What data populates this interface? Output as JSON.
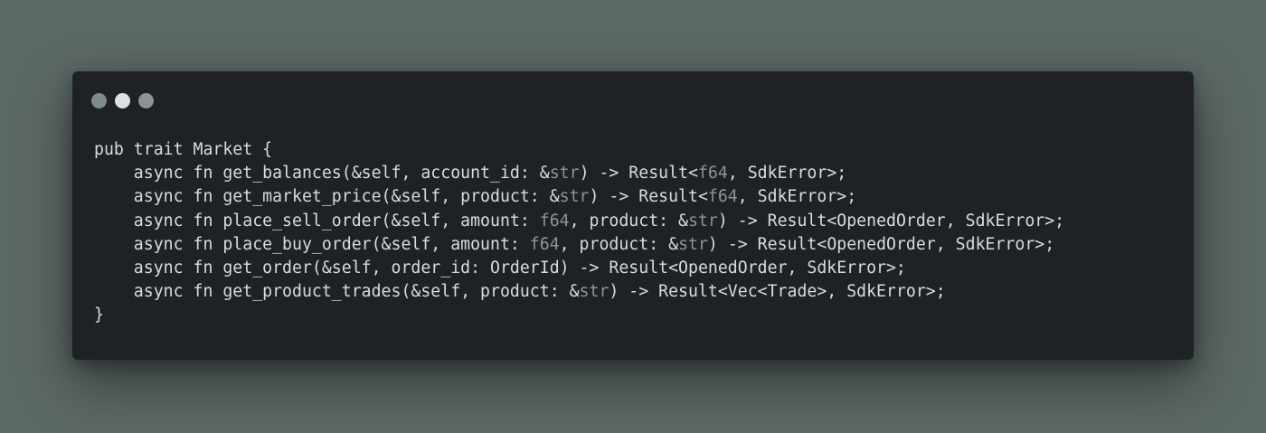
{
  "window": {
    "traffic_lights": [
      "close",
      "minimize",
      "maximize"
    ]
  },
  "colors": {
    "background": "#5c6866",
    "window": "#1e2224",
    "text": "#d9dcdc",
    "primitive_type": "#8b9594"
  },
  "code": {
    "language": "rust",
    "lines": [
      [
        {
          "t": "pub trait Market {",
          "c": "tk"
        }
      ],
      [
        {
          "t": "    async fn get_balances(&self, account_id: &",
          "c": "tk"
        },
        {
          "t": "str",
          "c": "tk-prim"
        },
        {
          "t": ") -> Result<",
          "c": "tk"
        },
        {
          "t": "f64",
          "c": "tk-prim"
        },
        {
          "t": ", SdkError>;",
          "c": "tk"
        }
      ],
      [
        {
          "t": "    async fn get_market_price(&self, product: &",
          "c": "tk"
        },
        {
          "t": "str",
          "c": "tk-prim"
        },
        {
          "t": ") -> Result<",
          "c": "tk"
        },
        {
          "t": "f64",
          "c": "tk-prim"
        },
        {
          "t": ", SdkError>;",
          "c": "tk"
        }
      ],
      [
        {
          "t": "    async fn place_sell_order(&self, amount: ",
          "c": "tk"
        },
        {
          "t": "f64",
          "c": "tk-prim"
        },
        {
          "t": ", product: &",
          "c": "tk"
        },
        {
          "t": "str",
          "c": "tk-prim"
        },
        {
          "t": ") -> Result<OpenedOrder, SdkError>;",
          "c": "tk"
        }
      ],
      [
        {
          "t": "    async fn place_buy_order(&self, amount: ",
          "c": "tk"
        },
        {
          "t": "f64",
          "c": "tk-prim"
        },
        {
          "t": ", product: &",
          "c": "tk"
        },
        {
          "t": "str",
          "c": "tk-prim"
        },
        {
          "t": ") -> Result<OpenedOrder, SdkError>;",
          "c": "tk"
        }
      ],
      [
        {
          "t": "    async fn get_order(&self, order_id: OrderId) -> Result<OpenedOrder, SdkError>;",
          "c": "tk"
        }
      ],
      [
        {
          "t": "    async fn get_product_trades(&self, product: &",
          "c": "tk"
        },
        {
          "t": "str",
          "c": "tk-prim"
        },
        {
          "t": ") -> Result<Vec<Trade>, SdkError>;",
          "c": "tk"
        }
      ],
      [
        {
          "t": "}",
          "c": "tk"
        }
      ]
    ]
  }
}
